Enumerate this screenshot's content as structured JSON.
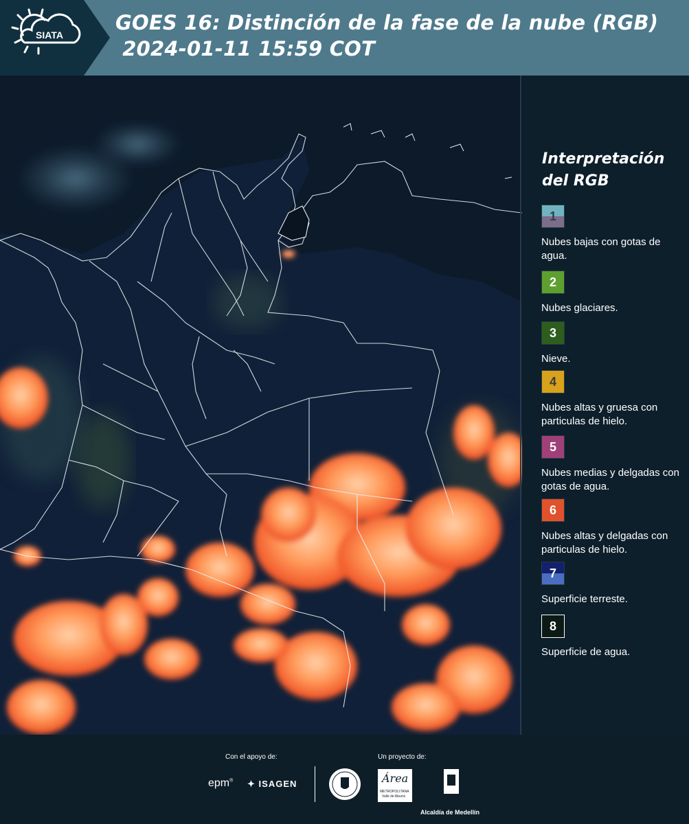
{
  "header": {
    "logo_text": "SIATA",
    "title_line1": "GOES 16: Distinción de la fase de la nube (RGB)",
    "title_line2": " 2024-01-11 15:59 COT",
    "bg_color": "#4e7a8c",
    "logo_bg_color": "#11303f"
  },
  "legend": {
    "title_line1": "Interpretación",
    "title_line2": "del RGB",
    "items": [
      {
        "num": "1",
        "label": "Nubes bajas con gotas de agua.",
        "color_top": "#6fb3c0",
        "color_bottom": "#7b6e8a",
        "num_color": "#3a3a4a"
      },
      {
        "num": "2",
        "label": "Nubes glaciares.",
        "color_top": "#5ea02f",
        "color_bottom": "#5ea02f",
        "num_color": "#ffffff"
      },
      {
        "num": "3",
        "label": "Nieve.",
        "color_top": "#2e5e1e",
        "color_bottom": "#2e5e1e",
        "num_color": "#ffffff"
      },
      {
        "num": "4",
        "label": "Nubes altas y gruesa con particulas de hielo.",
        "color_top": "#d9a21c",
        "color_bottom": "#d9a21c",
        "num_color": "#3a3a3a"
      },
      {
        "num": "5",
        "label": "Nubes medias y delgadas con gotas de agua.",
        "color_top": "#a0407a",
        "color_bottom": "#a0407a",
        "num_color": "#ffffff"
      },
      {
        "num": "6",
        "label": "Nubes altas y delgadas con particulas de hielo.",
        "color_top": "#e0522c",
        "color_bottom": "#e0522c",
        "num_color": "#ffffff"
      },
      {
        "num": "7",
        "label": "Superficie terreste.",
        "color_top": "#12206e",
        "color_bottom": "#4a6ec0",
        "num_color": "#ffffff"
      },
      {
        "num": "8",
        "label": "Superficie de agua.",
        "color_top": "#0b1a14",
        "color_bottom": "#0b1a14",
        "num_color": "#ffffff"
      }
    ]
  },
  "footer": {
    "support_label": "Con el apoyo de:",
    "project_label": "Un proyecto de:",
    "sponsor_epm": "epm",
    "sponsor_isagen": "ISAGEN",
    "area_text": "Área",
    "area_sub1": "METROPOLITANA",
    "area_sub2": "Valle de Aburrá",
    "alcaldia": "Alcaldía de Medellín"
  }
}
